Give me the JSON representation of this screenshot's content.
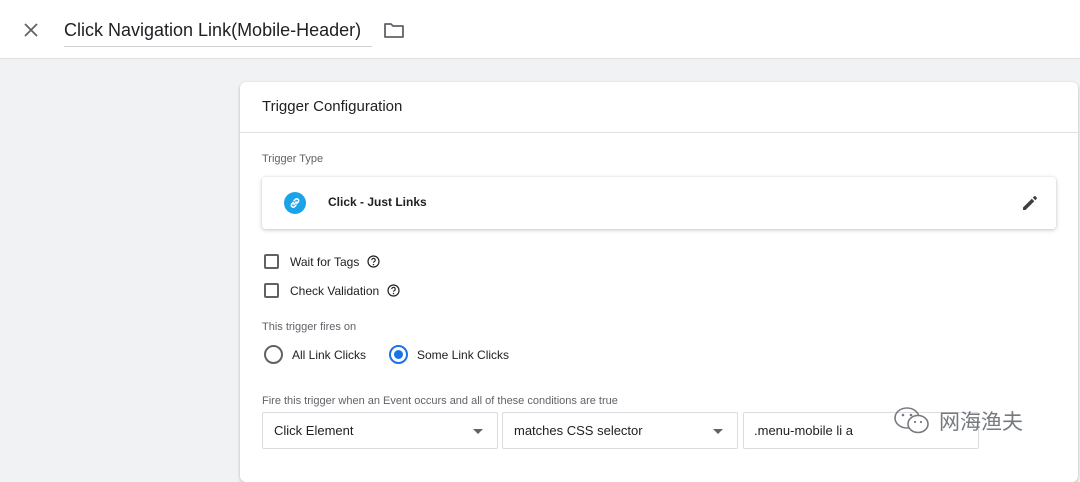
{
  "header": {
    "title": "Click Navigation Link(Mobile-Header)",
    "close_icon": "close-icon",
    "folder_icon": "folder-icon"
  },
  "card": {
    "title": "Trigger Configuration",
    "trigger_type_label": "Trigger Type",
    "trigger_type": {
      "name": "Click - Just Links",
      "icon": "link-icon",
      "icon_color": "#1aa3e8",
      "edit_icon": "pencil-icon"
    },
    "options": [
      {
        "label": "Wait for Tags",
        "checked": false
      },
      {
        "label": "Check Validation",
        "checked": false
      }
    ],
    "fires_on_label": "This trigger fires on",
    "fires_on": [
      {
        "label": "All Link Clicks",
        "selected": false
      },
      {
        "label": "Some Link Clicks",
        "selected": true
      }
    ],
    "conditions_label": "Fire this trigger when an Event occurs and all of these conditions are true",
    "condition": {
      "variable": "Click Element",
      "operator": "matches CSS selector",
      "value": ".menu-mobile li a"
    }
  },
  "colors": {
    "accent": "#1a73e8",
    "link_icon_bg": "#1aa3e8",
    "page_bg": "#f1f2f3"
  },
  "watermark": {
    "text": "网海渔夫",
    "icon": "wechat-icon"
  }
}
